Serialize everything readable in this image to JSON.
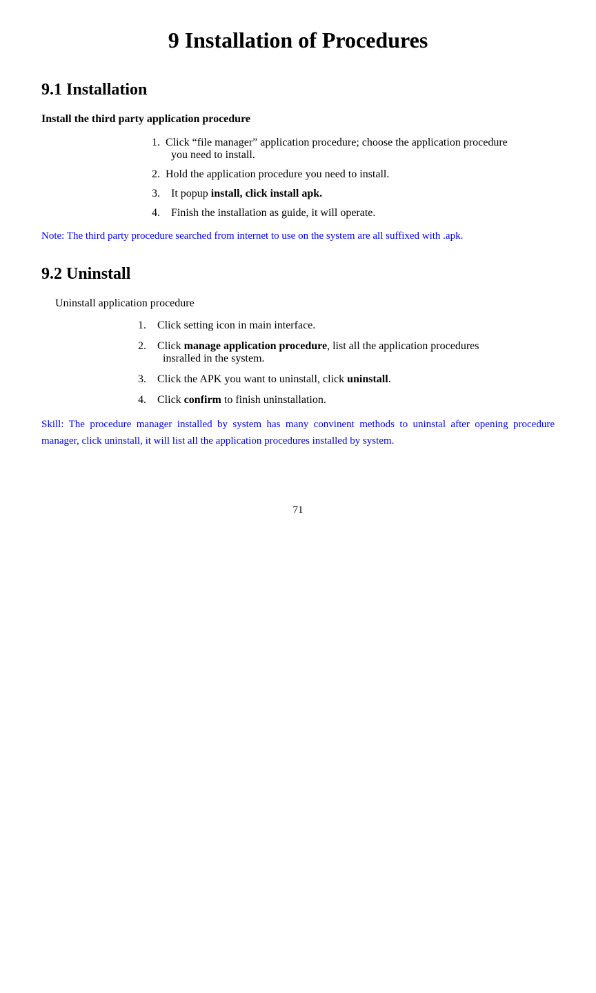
{
  "page": {
    "title": "9 Installation of Procedures",
    "page_number": "71"
  },
  "section91": {
    "heading": "9.1 Installation",
    "subsection_label": "Install the third party application procedure",
    "steps": [
      {
        "number": "1.",
        "text": "Click “file manager” application procedure; choose the application procedure you need to install."
      },
      {
        "number": "2.",
        "text": "Hold the application procedure you need to install."
      },
      {
        "number": "3.",
        "text": "It popup ",
        "bold_text": "install, click install apk."
      },
      {
        "number": "4.",
        "text": "Finish the installation as guide, it will operate."
      }
    ],
    "note": "Note: The third party procedure searched from internet to use on the system are all suffixed with .apk."
  },
  "section92": {
    "heading": "9.2 Uninstall",
    "uninstall_label": "Uninstall application procedure",
    "steps": [
      {
        "number": "1.",
        "text": "Click setting icon in main interface."
      },
      {
        "number": "2.",
        "text": "Click ",
        "bold_text": "manage application procedure",
        "text2": ", list all the application procedures insralled in the system."
      },
      {
        "number": "3.",
        "text": "Click the APK you want to uninstall, click ",
        "bold_text": "uninstall",
        "text2": "."
      },
      {
        "number": "4.",
        "text": "Click ",
        "bold_text": "confirm",
        "text2": " to finish uninstallation."
      }
    ],
    "skill": "Skill: The procedure manager installed by system has many convinent methods to uninstal after opening procedure manager, click uninstall, it will list all the application procedures installed by system."
  }
}
